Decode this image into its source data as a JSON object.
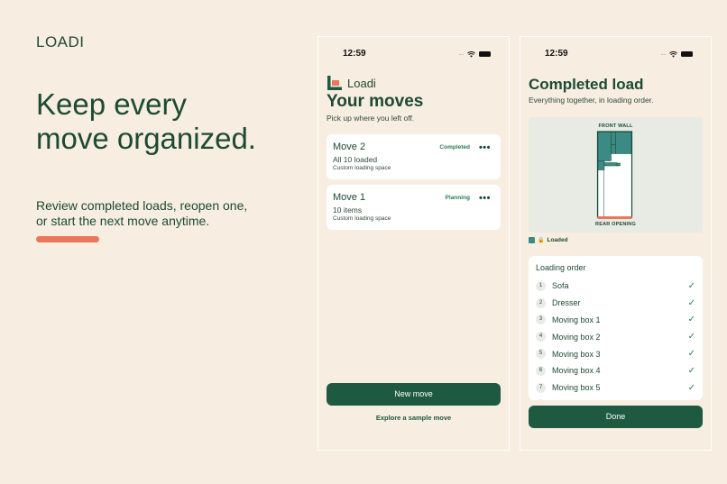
{
  "brand": "LOADI",
  "headline_line1": "Keep every",
  "headline_line2": "move organized.",
  "subhead": "Review completed loads, reopen one, or start the next move anytime.",
  "colors": {
    "background": "#f7ede0",
    "primary": "#1e5942",
    "accent": "#e9775a",
    "loaded": "#3b8a86",
    "text": "#1d4a34"
  },
  "status_bar": {
    "time": "12:59",
    "signal": "....",
    "icons": [
      "wifi-icon",
      "battery-icon"
    ]
  },
  "moves_screen": {
    "app_name": "Loadi",
    "title": "Your moves",
    "subtitle": "Pick up where you left off.",
    "moves": [
      {
        "name": "Move 2",
        "status": "Completed",
        "detail": "All 10 loaded",
        "space": "Custom loading space",
        "more": "•••"
      },
      {
        "name": "Move 1",
        "status": "Planning",
        "detail": "10 items",
        "space": "Custom loading space",
        "more": "•••"
      }
    ],
    "new_move_label": "New move",
    "sample_link": "Explore a sample move"
  },
  "completed_screen": {
    "title": "Completed load",
    "subtitle": "Everything together, in loading order.",
    "front_label": "FRONT WALL",
    "rear_label": "REAR OPENING",
    "legend_label": "Loaded",
    "order_title": "Loading order",
    "items": [
      {
        "num": "1",
        "name": "Sofa",
        "check": "✓"
      },
      {
        "num": "2",
        "name": "Dresser",
        "check": "✓"
      },
      {
        "num": "3",
        "name": "Moving box 1",
        "check": "✓"
      },
      {
        "num": "4",
        "name": "Moving box 2",
        "check": "✓"
      },
      {
        "num": "5",
        "name": "Moving box 3",
        "check": "✓"
      },
      {
        "num": "6",
        "name": "Moving box 4",
        "check": "✓"
      },
      {
        "num": "7",
        "name": "Moving box 5",
        "check": "✓"
      }
    ],
    "done_label": "Done"
  }
}
